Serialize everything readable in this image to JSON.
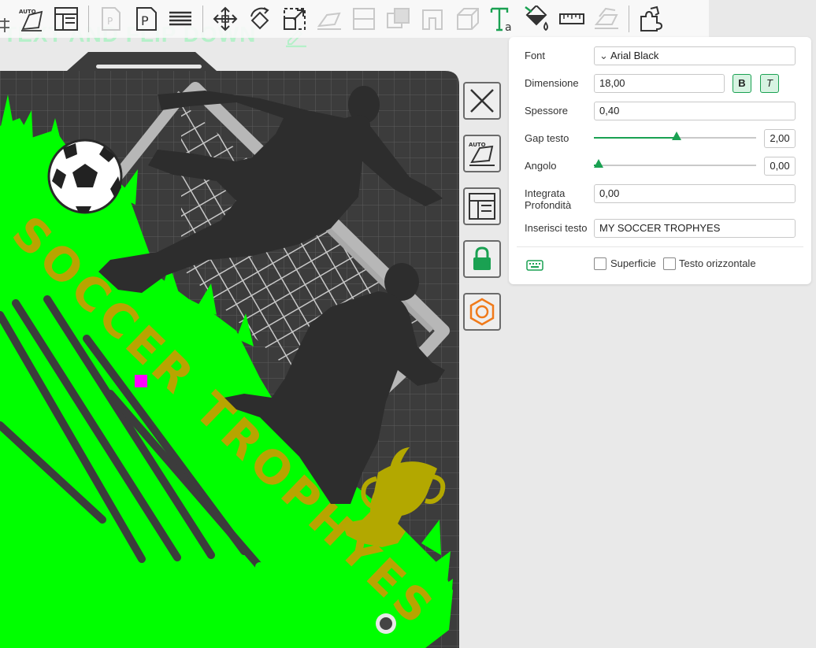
{
  "viewport": {
    "plate_title": "TEXT AND FLIP DOWN",
    "model_text": "SOCCER TROPHYES"
  },
  "toolbar": {
    "items": [
      {
        "icon": "arrange-icon"
      },
      {
        "icon": "auto-orient-icon",
        "badge": "AUTO"
      },
      {
        "icon": "layout-icon"
      },
      {
        "icon": "page-icon"
      },
      {
        "icon": "plate-p-icon",
        "badge": "P"
      },
      {
        "icon": "lines-icon"
      },
      {
        "icon": "move-icon"
      },
      {
        "icon": "rotate-icon"
      },
      {
        "icon": "scale-icon"
      },
      {
        "icon": "lay-on-face-icon"
      },
      {
        "icon": "cut-icon"
      },
      {
        "icon": "boolean-icon"
      },
      {
        "icon": "support-paint-icon"
      },
      {
        "icon": "cube-icon"
      },
      {
        "icon": "text-icon",
        "badge": "Ta"
      },
      {
        "icon": "paint-bucket-icon"
      },
      {
        "icon": "measure-icon"
      },
      {
        "icon": "assembly-icon"
      },
      {
        "icon": "puzzle-icon"
      }
    ]
  },
  "side_tools": {
    "items": [
      {
        "icon": "delete-x-icon"
      },
      {
        "icon": "auto-arrange-icon",
        "badge": "AUTO"
      },
      {
        "icon": "layout-icon"
      },
      {
        "icon": "lock-icon"
      },
      {
        "icon": "hex-nut-icon"
      }
    ]
  },
  "panel": {
    "font_label": "Font",
    "font_value": "Arial Black",
    "size_label": "Dimensione",
    "size_value": "18,00",
    "bold_label": "B",
    "italic_label": "T",
    "thickness_label": "Spessore",
    "thickness_value": "0,40",
    "gap_label": "Gap testo",
    "gap_value": "2,00",
    "gap_fraction": 0.51,
    "angle_label": "Angolo",
    "angle_value": "0,00",
    "angle_fraction": 0.03,
    "depth_label": "Integrata Profondità",
    "depth_value": "0,00",
    "text_label": "Inserisci testo",
    "text_value": "MY SOCCER TROPHYES",
    "surface_label": "Superficie",
    "horizontal_label": "Testo orizzontale",
    "surface_checked": false,
    "horizontal_checked": false
  },
  "colors": {
    "accent": "#1aa152",
    "grass": "#00ff00",
    "text_gold": "#b8a400",
    "plate": "#3a3a3a",
    "silhouette": "#2e2e2e",
    "selection_marker": "#ff00ff",
    "hex_orange": "#f07a1a"
  }
}
